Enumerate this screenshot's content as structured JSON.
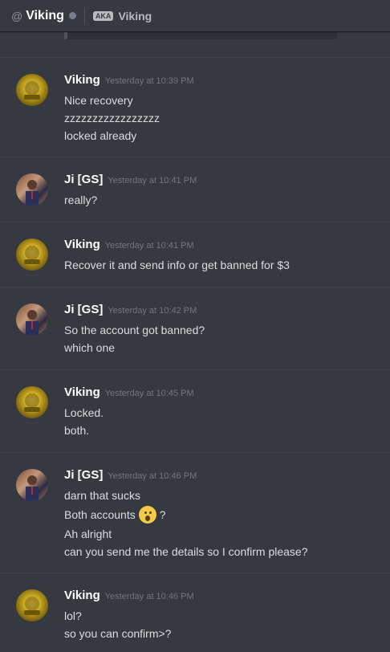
{
  "header": {
    "at_symbol": "@",
    "dm_name": "Viking",
    "aka_badge": "AKA",
    "aka_name": "Viking"
  },
  "messages": [
    {
      "author": "Viking",
      "timestamp": "Yesterday at 10:39 PM",
      "lines": [
        "Nice recovery",
        "zzzzzzzzzzzzzzzzz",
        "locked already"
      ]
    },
    {
      "author": "Ji [GS]",
      "timestamp": "Yesterday at 10:41 PM",
      "lines": [
        "really?"
      ]
    },
    {
      "author": "Viking",
      "timestamp": "Yesterday at 10:41 PM",
      "lines": [
        "Recover it and send info or get banned for $3"
      ]
    },
    {
      "author": "Ji [GS]",
      "timestamp": "Yesterday at 10:42 PM",
      "lines": [
        "So the account got banned?",
        "which one"
      ]
    },
    {
      "author": "Viking",
      "timestamp": "Yesterday at 10:45 PM",
      "lines": [
        "Locked.",
        "both."
      ]
    },
    {
      "author": "Ji [GS]",
      "timestamp": "Yesterday at 10:46 PM",
      "lines": [
        "darn that sucks",
        "Both accounts",
        "?",
        "Ah alright",
        "can you send me the details so I confirm please?"
      ]
    },
    {
      "author": "Viking",
      "timestamp": "Yesterday at 10:46 PM",
      "lines": [
        "lol?",
        "so you can confirm>?"
      ]
    }
  ],
  "emoji": "astonished-face-emoji",
  "colors": {
    "background": "#36393f",
    "author": "#ffffff",
    "text": "#dcddde",
    "timestamp": "#72767d"
  }
}
